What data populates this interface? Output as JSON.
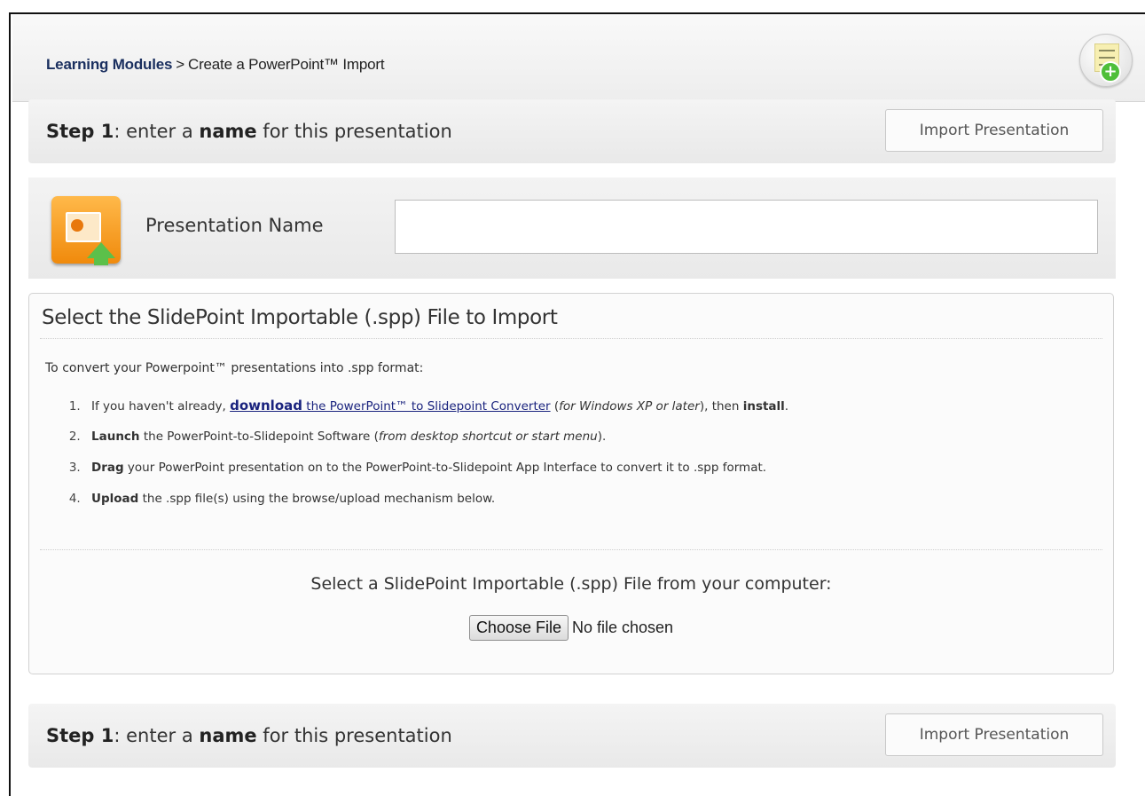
{
  "breadcrumb": {
    "root": "Learning Modules",
    "separator": ">",
    "current": "Create a PowerPoint™ Import"
  },
  "header_icon": "add-note-icon",
  "step_top": {
    "prefix": "Step 1",
    "text1": ": enter a ",
    "bold": "name",
    "text2": " for this presentation",
    "button": "Import Presentation"
  },
  "name_panel": {
    "icon": "powerpoint-import-icon",
    "label": "Presentation Name",
    "value": ""
  },
  "select_panel": {
    "title": "Select the SlidePoint Importable (.spp) File to Import",
    "intro": "To convert your Powerpoint™ presentations into .spp format:",
    "steps": [
      {
        "t1": "If you haven't already, ",
        "link_bold": "download",
        "link_rest": " the PowerPoint™ to Slidepoint Converter",
        "t2": " (",
        "italic": "for Windows XP or later",
        "t3": "), then ",
        "bold_end": "install",
        "t4": "."
      },
      {
        "bold": "Launch",
        "t1": " the PowerPoint-to-Slidepoint Software (",
        "italic": "from desktop shortcut or start menu",
        "t2": ")."
      },
      {
        "bold": "Drag",
        "t1": " your PowerPoint presentation on to the PowerPoint-to-Slidepoint App Interface to convert it to .spp format."
      },
      {
        "bold": "Upload",
        "t1": " the .spp file(s) using the browse/upload mechanism below."
      }
    ],
    "file_label": "Select a SlidePoint Importable (.spp) File from your computer:",
    "choose_button": "Choose File",
    "no_file": "No file chosen"
  },
  "step_bottom": {
    "prefix": "Step 1",
    "text1": ": enter a ",
    "bold": "name",
    "text2": " for this presentation",
    "button": "Import Presentation"
  }
}
